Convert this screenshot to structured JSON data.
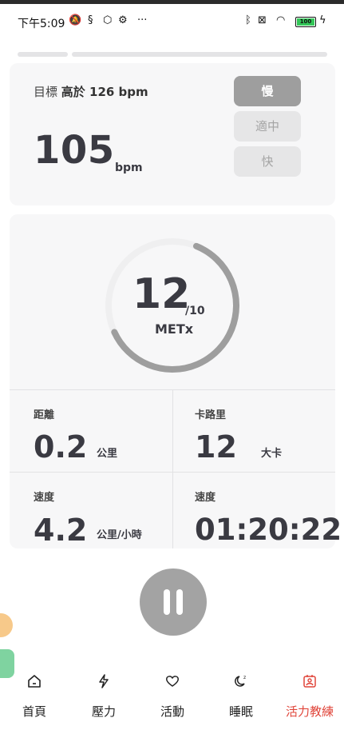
{
  "status_bar": {
    "time": "下午5:09",
    "battery": "100"
  },
  "target": {
    "prefix": "目標",
    "value": "高於 126 bpm"
  },
  "heart_rate": {
    "value": "105",
    "unit": "bpm"
  },
  "pace_buttons": [
    {
      "label": "慢",
      "active": true
    },
    {
      "label": "適中",
      "active": false
    },
    {
      "label": "快",
      "active": false
    }
  ],
  "mets": {
    "value": "12",
    "max": "/10",
    "unit": "METx",
    "progress": 0.62
  },
  "stats": [
    {
      "label": "距離",
      "value": "0.2",
      "unit": "公里"
    },
    {
      "label": "卡路里",
      "value": "12",
      "unit": "大卡"
    },
    {
      "label": "速度",
      "value": "4.2",
      "unit": "公里/小時"
    },
    {
      "label": "速度",
      "value": "01:20:22",
      "unit": ""
    }
  ],
  "nav": [
    {
      "label": "首頁",
      "icon": "home-icon",
      "active": false
    },
    {
      "label": "壓力",
      "icon": "lightning-icon",
      "active": false
    },
    {
      "label": "活動",
      "icon": "heart-icon",
      "active": false
    },
    {
      "label": "睡眠",
      "icon": "moon-icon",
      "active": false
    },
    {
      "label": "活力教練",
      "icon": "coach-icon",
      "active": true
    }
  ],
  "colors": {
    "accent": "#e0453a",
    "ring_track": "#efeff0",
    "ring_fill": "#9e9e9e",
    "card_bg": "#f7f7f8"
  }
}
